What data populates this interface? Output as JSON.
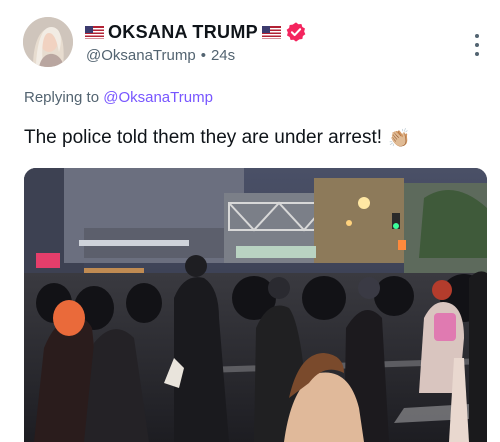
{
  "post": {
    "display_name": "OKSANA TRUMP",
    "name_prefix_flag": "us-flag-icon",
    "name_suffix_flag": "us-flag-icon",
    "verified_icon": "verified-badge-icon",
    "handle": "@OksanaTrump",
    "separator": "•",
    "time": "24s",
    "replying_label": "Replying to",
    "replying_handle": "@OksanaTrump",
    "text": "The police told them they are under arrest!",
    "emoji": "👏🏼"
  },
  "colors": {
    "accent": "#7856ff",
    "verified": "#f4245e",
    "muted": "#536471"
  }
}
